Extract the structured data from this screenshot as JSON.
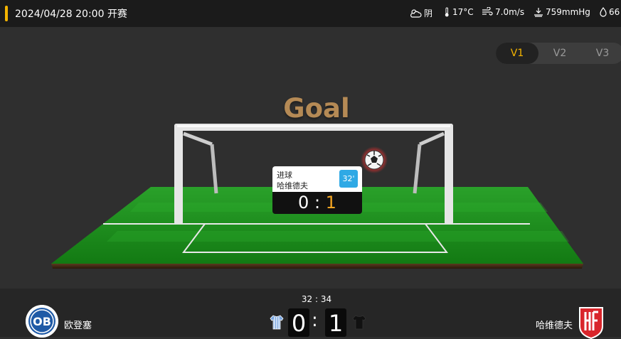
{
  "header": {
    "match_time": "2024/04/28 20:00 开赛",
    "weather": {
      "condition": "阴",
      "temperature": "17°C",
      "wind": "7.0m/s",
      "pressure": "759mmHg",
      "humidity": "66"
    },
    "accent_color": "#f5b400"
  },
  "view_toggle": {
    "options": [
      "V1",
      "V2",
      "V3"
    ],
    "selected": "V1"
  },
  "event": {
    "title": "Goal"
  },
  "popup": {
    "type": "进球",
    "team": "哈维德夫",
    "minute": "32'",
    "home_score": "0",
    "away_score": "1"
  },
  "scoreboard": {
    "clock": "32 : 34",
    "home_team": "欧登塞",
    "home_logo_text": "OB",
    "home_score": "0",
    "away_team": "哈维德夫",
    "away_logo_text": "HF",
    "away_score": "1",
    "separator": ":"
  },
  "colors": {
    "pitch_green": "#1e8f1e",
    "title_color": "#b58a55",
    "minute_badge": "#2fa9e5",
    "away_score_color": "#f5a623"
  }
}
